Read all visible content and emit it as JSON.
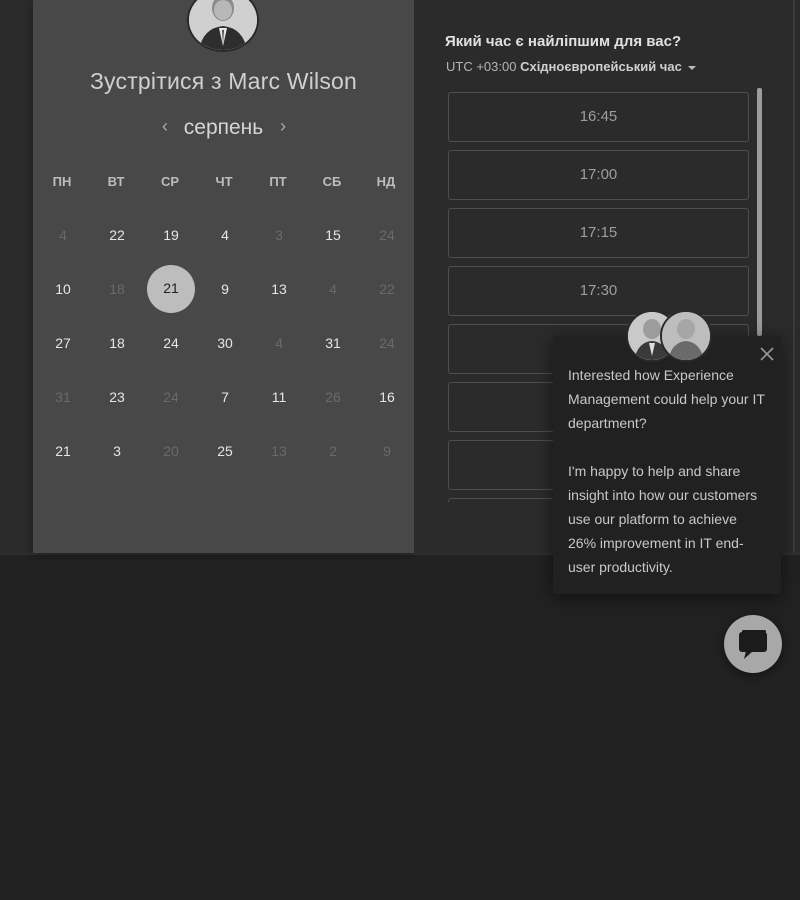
{
  "colors": {
    "accent_selected": "#bdbdbd",
    "card_bg": "#484848",
    "page_bg": "#222222"
  },
  "scheduler": {
    "host_avatar_icon": "host-avatar",
    "title": "Зустрітися з Marc Wilson",
    "month": "серпень",
    "prev_icon": "chevron-left-icon",
    "next_icon": "chevron-right-icon",
    "weekdays": [
      "ПН",
      "ВТ",
      "СР",
      "ЧТ",
      "ПТ",
      "СБ",
      "НД"
    ],
    "weeks": [
      [
        {
          "d": "4",
          "on": false
        },
        {
          "d": "22",
          "on": true
        },
        {
          "d": "19",
          "on": true
        },
        {
          "d": "4",
          "on": true
        },
        {
          "d": "3",
          "on": false
        },
        {
          "d": "15",
          "on": true
        },
        {
          "d": "24",
          "on": false
        }
      ],
      [
        {
          "d": "10",
          "on": true
        },
        {
          "d": "18",
          "on": false
        },
        {
          "d": "21",
          "on": true,
          "selected": true
        },
        {
          "d": "9",
          "on": true
        },
        {
          "d": "13",
          "on": true
        },
        {
          "d": "4",
          "on": false
        },
        {
          "d": "22",
          "on": false
        }
      ],
      [
        {
          "d": "27",
          "on": true
        },
        {
          "d": "18",
          "on": true
        },
        {
          "d": "24",
          "on": true
        },
        {
          "d": "30",
          "on": true
        },
        {
          "d": "4",
          "on": false
        },
        {
          "d": "31",
          "on": true
        },
        {
          "d": "24",
          "on": false
        }
      ],
      [
        {
          "d": "31",
          "on": false
        },
        {
          "d": "23",
          "on": true
        },
        {
          "d": "24",
          "on": false
        },
        {
          "d": "7",
          "on": true
        },
        {
          "d": "11",
          "on": true
        },
        {
          "d": "26",
          "on": false
        },
        {
          "d": "16",
          "on": true
        }
      ],
      [
        {
          "d": "21",
          "on": true
        },
        {
          "d": "3",
          "on": true
        },
        {
          "d": "20",
          "on": false
        },
        {
          "d": "25",
          "on": true
        },
        {
          "d": "13",
          "on": false
        },
        {
          "d": "2",
          "on": false
        },
        {
          "d": "9",
          "on": false
        }
      ]
    ],
    "question": "Який час є найліпшим для вас?",
    "tz_offset": "UTC +03:00",
    "tz_name": "Східноєвропейський час",
    "slots": [
      "16:45",
      "17:00",
      "17:15",
      "17:30",
      "",
      "",
      "",
      ""
    ]
  },
  "chat": {
    "close_icon": "close-icon",
    "message_1": "Interested how Experience Management could help your IT department?",
    "message_2": "I'm happy to help and share insight into how our customers use our platform to achieve 26% improvement in IT end-user productivity.",
    "fab_icon": "chat-bubble-icon"
  }
}
